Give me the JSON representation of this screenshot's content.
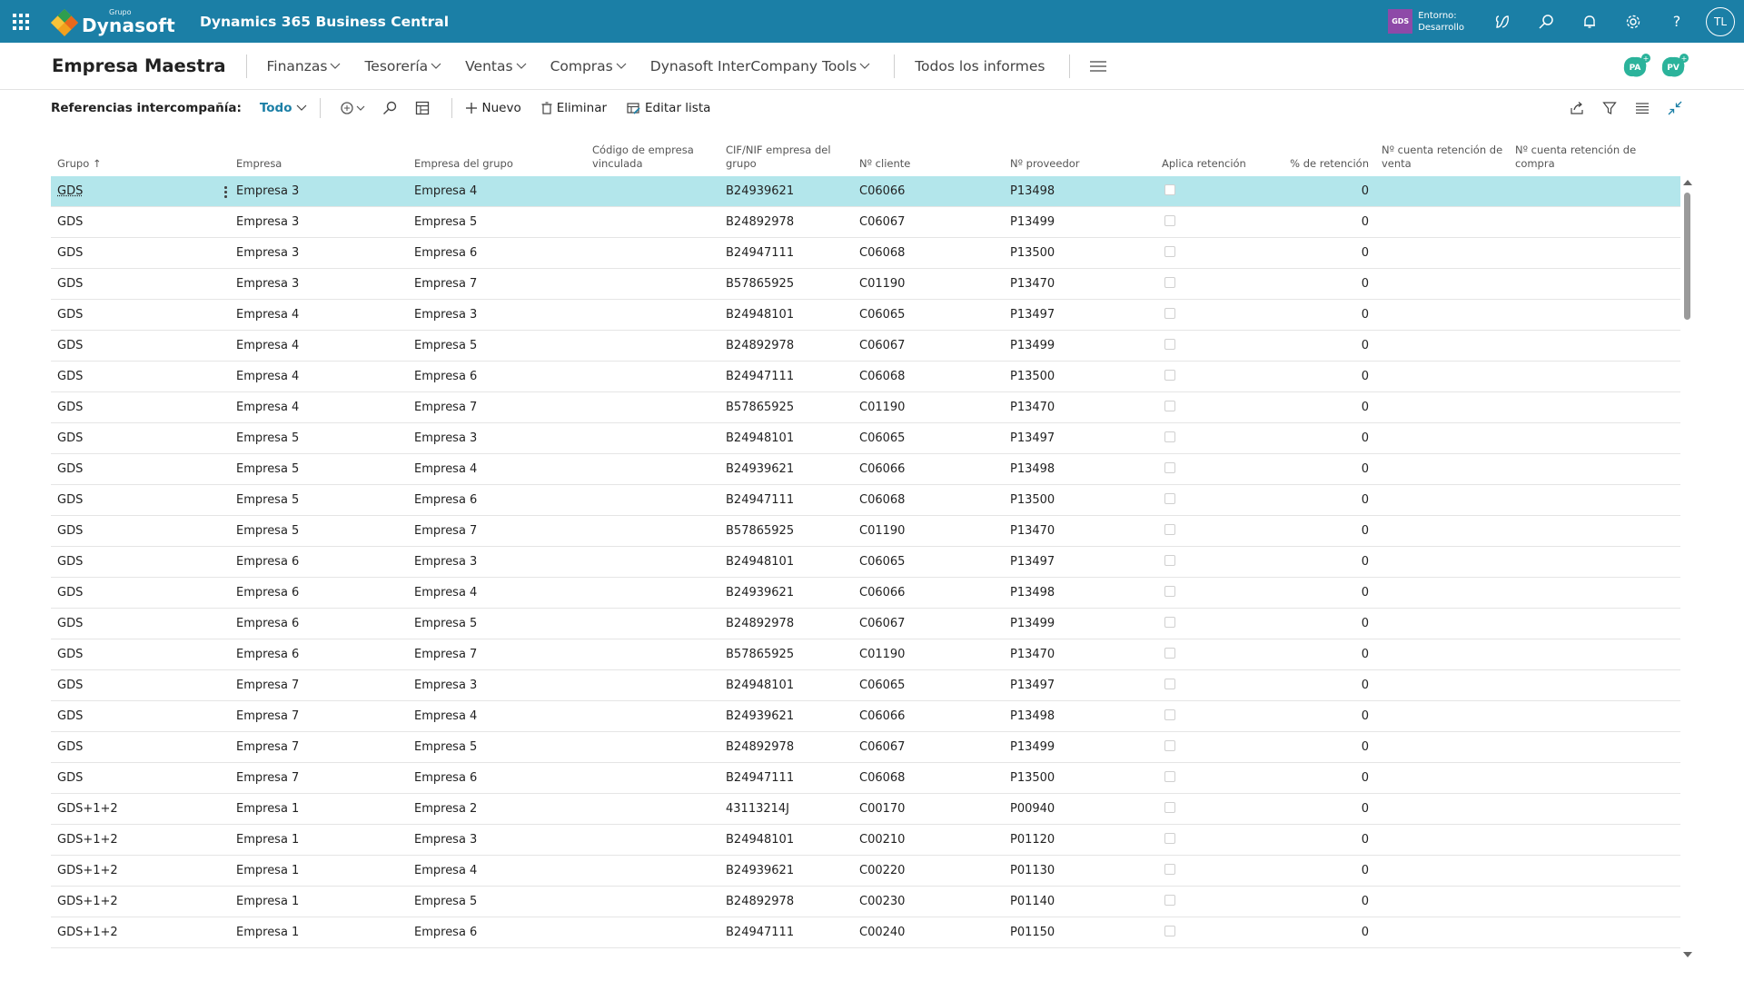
{
  "suite": {
    "brand_small": "Grupo",
    "brand_name": "Dynasoft",
    "product": "Dynamics 365 Business Central",
    "env_badge": "GDS",
    "env_line1": "Entorno:",
    "env_line2": "Desarrollo",
    "user_initials": "TL"
  },
  "nav": {
    "company": "Empresa Maestra",
    "menus": [
      "Finanzas",
      "Tesorería",
      "Ventas",
      "Compras",
      "Dynasoft InterCompany Tools"
    ],
    "reports": "Todos los informes",
    "personas": [
      "PA",
      "PV"
    ]
  },
  "actions": {
    "page_label": "Referencias intercompañía:",
    "view": "Todo",
    "new": "Nuevo",
    "delete": "Eliminar",
    "edit_list": "Editar lista"
  },
  "columns": {
    "grupo": "Grupo",
    "empresa": "Empresa",
    "empresa_grupo": "Empresa del grupo",
    "codigo": "Código de empresa vinculada",
    "cif": "CIF/NIF empresa del grupo",
    "cliente": "Nº cliente",
    "proveedor": "Nº proveedor",
    "aplica": "Aplica retención",
    "retencion": "% de retención",
    "cta_venta": "Nº cuenta retención de venta",
    "cta_compra": "Nº cuenta retención de compra"
  },
  "rows": [
    [
      "GDS",
      "Empresa 3",
      "Empresa 4",
      "",
      "B24939621",
      "C06066",
      "P13498",
      "0"
    ],
    [
      "GDS",
      "Empresa 3",
      "Empresa 5",
      "",
      "B24892978",
      "C06067",
      "P13499",
      "0"
    ],
    [
      "GDS",
      "Empresa 3",
      "Empresa 6",
      "",
      "B24947111",
      "C06068",
      "P13500",
      "0"
    ],
    [
      "GDS",
      "Empresa 3",
      "Empresa 7",
      "",
      "B57865925",
      "C01190",
      "P13470",
      "0"
    ],
    [
      "GDS",
      "Empresa 4",
      "Empresa 3",
      "",
      "B24948101",
      "C06065",
      "P13497",
      "0"
    ],
    [
      "GDS",
      "Empresa 4",
      "Empresa 5",
      "",
      "B24892978",
      "C06067",
      "P13499",
      "0"
    ],
    [
      "GDS",
      "Empresa 4",
      "Empresa 6",
      "",
      "B24947111",
      "C06068",
      "P13500",
      "0"
    ],
    [
      "GDS",
      "Empresa 4",
      "Empresa 7",
      "",
      "B57865925",
      "C01190",
      "P13470",
      "0"
    ],
    [
      "GDS",
      "Empresa 5",
      "Empresa 3",
      "",
      "B24948101",
      "C06065",
      "P13497",
      "0"
    ],
    [
      "GDS",
      "Empresa 5",
      "Empresa 4",
      "",
      "B24939621",
      "C06066",
      "P13498",
      "0"
    ],
    [
      "GDS",
      "Empresa 5",
      "Empresa 6",
      "",
      "B24947111",
      "C06068",
      "P13500",
      "0"
    ],
    [
      "GDS",
      "Empresa 5",
      "Empresa 7",
      "",
      "B57865925",
      "C01190",
      "P13470",
      "0"
    ],
    [
      "GDS",
      "Empresa 6",
      "Empresa 3",
      "",
      "B24948101",
      "C06065",
      "P13497",
      "0"
    ],
    [
      "GDS",
      "Empresa 6",
      "Empresa 4",
      "",
      "B24939621",
      "C06066",
      "P13498",
      "0"
    ],
    [
      "GDS",
      "Empresa 6",
      "Empresa 5",
      "",
      "B24892978",
      "C06067",
      "P13499",
      "0"
    ],
    [
      "GDS",
      "Empresa 6",
      "Empresa 7",
      "",
      "B57865925",
      "C01190",
      "P13470",
      "0"
    ],
    [
      "GDS",
      "Empresa 7",
      "Empresa 3",
      "",
      "B24948101",
      "C06065",
      "P13497",
      "0"
    ],
    [
      "GDS",
      "Empresa 7",
      "Empresa 4",
      "",
      "B24939621",
      "C06066",
      "P13498",
      "0"
    ],
    [
      "GDS",
      "Empresa 7",
      "Empresa 5",
      "",
      "B24892978",
      "C06067",
      "P13499",
      "0"
    ],
    [
      "GDS",
      "Empresa 7",
      "Empresa 6",
      "",
      "B24947111",
      "C06068",
      "P13500",
      "0"
    ],
    [
      "GDS+1+2",
      "Empresa 1",
      "Empresa 2",
      "",
      "43113214J",
      "C00170",
      "P00940",
      "0"
    ],
    [
      "GDS+1+2",
      "Empresa 1",
      "Empresa 3",
      "",
      "B24948101",
      "C00210",
      "P01120",
      "0"
    ],
    [
      "GDS+1+2",
      "Empresa 1",
      "Empresa 4",
      "",
      "B24939621",
      "C00220",
      "P01130",
      "0"
    ],
    [
      "GDS+1+2",
      "Empresa 1",
      "Empresa 5",
      "",
      "B24892978",
      "C00230",
      "P01140",
      "0"
    ],
    [
      "GDS+1+2",
      "Empresa 1",
      "Empresa 6",
      "",
      "B24947111",
      "C00240",
      "P01150",
      "0"
    ]
  ],
  "colors": {
    "suite_bar": "#1b7fa6",
    "selected_row": "#b3e6eb",
    "env_badge": "#8e4aa8"
  }
}
